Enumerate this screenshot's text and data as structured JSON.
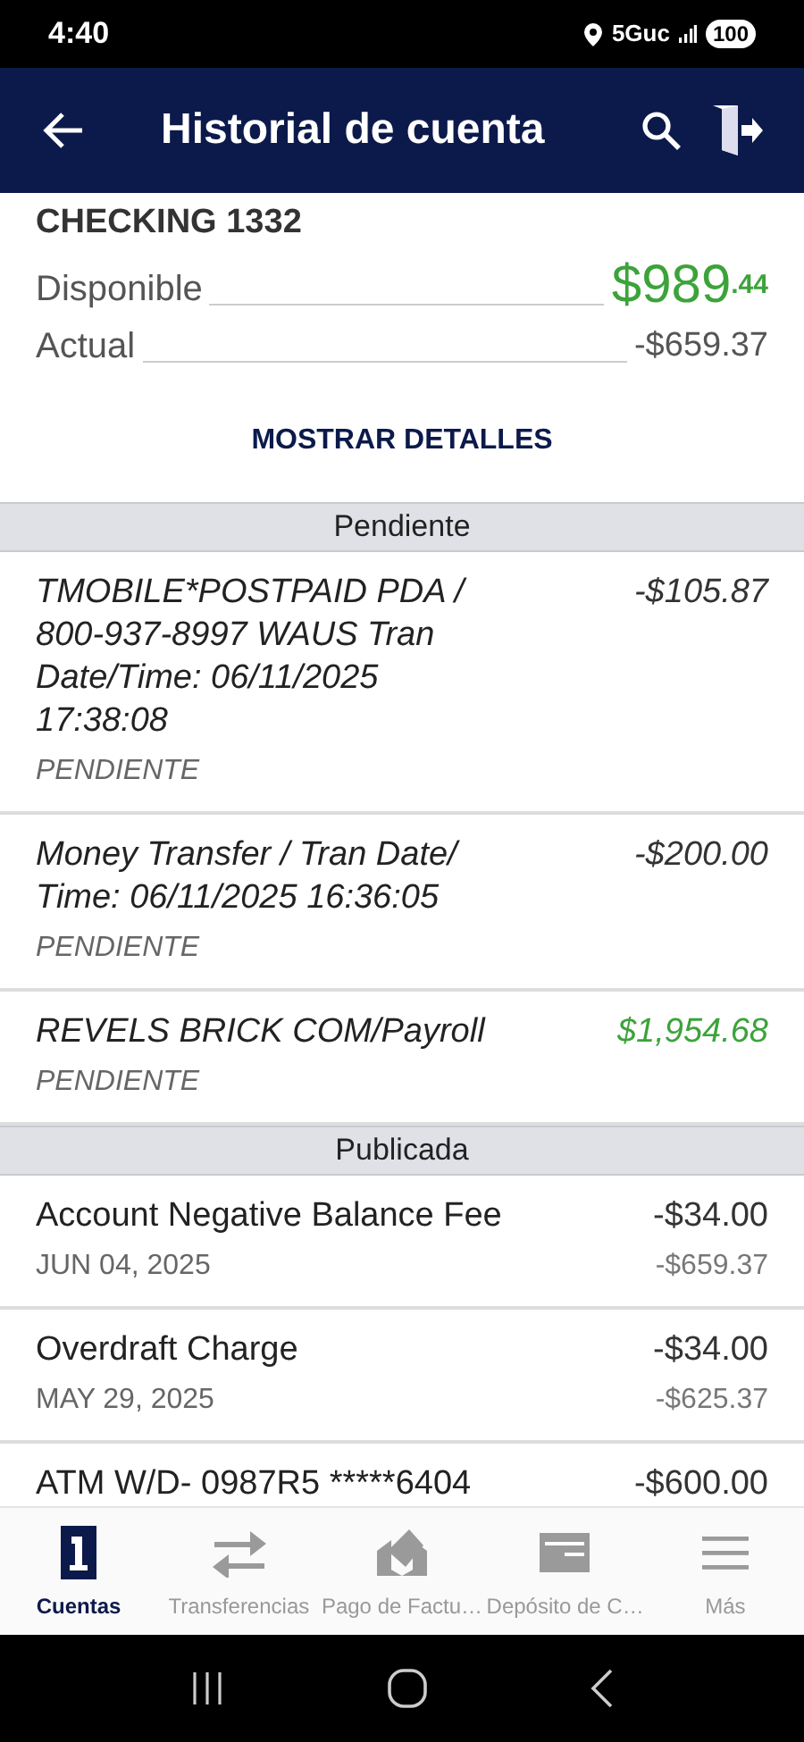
{
  "status_bar": {
    "time": "4:40",
    "network": "5Guc",
    "battery": "100"
  },
  "header": {
    "title": "Historial de cuenta"
  },
  "account": {
    "name": "CHECKING 1332",
    "available_label": "Disponible",
    "available_whole": "$989",
    "available_cents": ".44",
    "actual_label": "Actual",
    "actual_value": "-$659.37",
    "details_button": "MOSTRAR DETALLES"
  },
  "sections": [
    {
      "title": "Pendiente",
      "transactions": [
        {
          "kind": "debit",
          "pending": true,
          "description": "TMOBILE*POSTPAID PDA / 800-937-8997 WAUS Tran Date/Time: 06/11/2025 17:38:08",
          "amount": "-$105.87",
          "status": "PENDIENTE"
        },
        {
          "kind": "debit",
          "pending": true,
          "description": "Money Transfer / Tran Date/ Time: 06/11/2025 16:36:05",
          "amount": "-$200.00",
          "status": "PENDIENTE"
        },
        {
          "kind": "credit",
          "pending": true,
          "description": "REVELS BRICK COM/Payroll",
          "amount": "$1,954.68",
          "status": "PENDIENTE"
        }
      ]
    },
    {
      "title": "Publicada",
      "transactions": [
        {
          "kind": "debit",
          "pending": false,
          "description": "Account Negative Balance Fee",
          "amount": "-$34.00",
          "date": "JUN 04, 2025",
          "balance": "-$659.37"
        },
        {
          "kind": "debit",
          "pending": false,
          "description": "Overdraft Charge",
          "amount": "-$34.00",
          "date": "MAY 29, 2025",
          "balance": "-$625.37"
        },
        {
          "kind": "debit",
          "pending": false,
          "description": "ATM W/D- 0987R5 *****6404",
          "amount": "-$600.00"
        }
      ]
    }
  ],
  "bottom_nav": [
    {
      "label": "Cuentas",
      "selected": true
    },
    {
      "label": "Transferencias",
      "selected": false
    },
    {
      "label": "Pago de Factu…",
      "selected": false
    },
    {
      "label": "Depósito de C…",
      "selected": false
    },
    {
      "label": "Más",
      "selected": false
    }
  ]
}
